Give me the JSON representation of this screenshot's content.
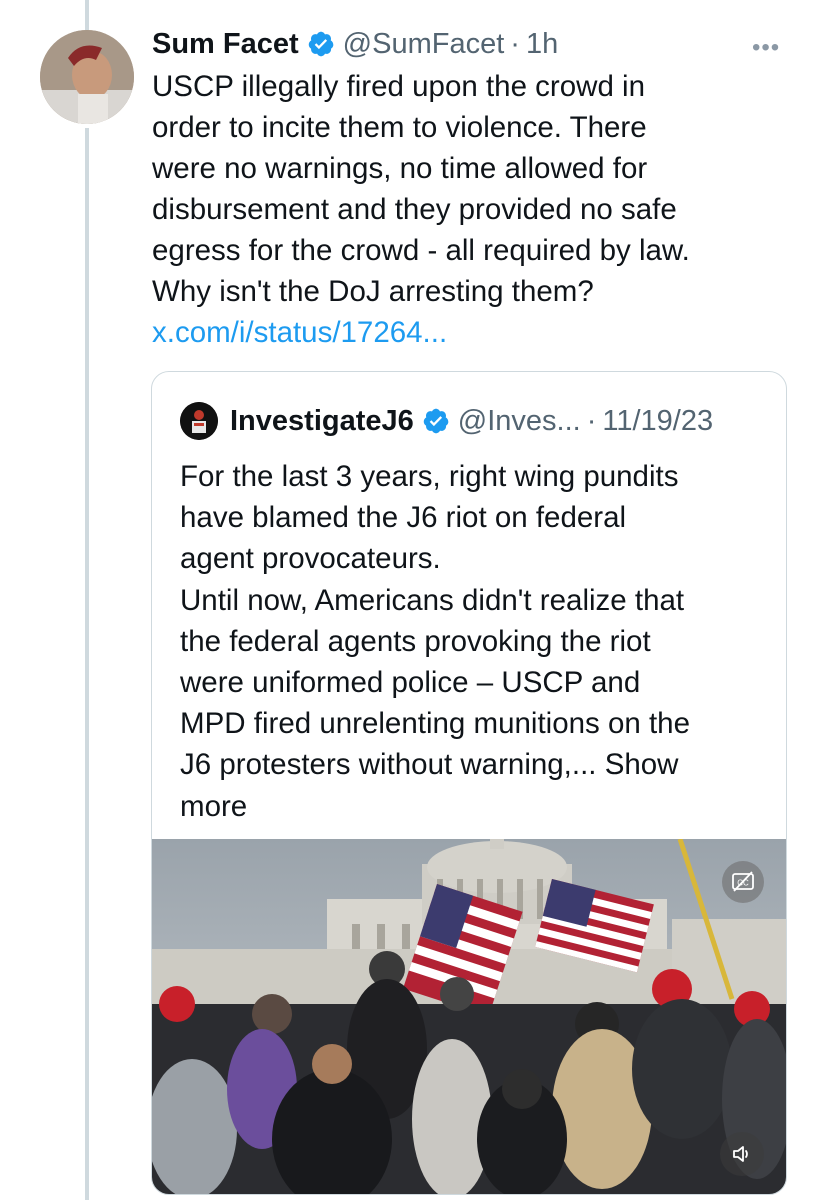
{
  "tweet": {
    "author_name": "Sum Facet",
    "handle": "@SumFacet",
    "separator": "·",
    "time": "1h",
    "more_label": "•••",
    "text": "USCP illegally fired upon the crowd in\norder to incite them to violence.  There\nwere no warnings, no time allowed for\ndisbursement and they provided no safe\negress for the crowd - all required by law.\nWhy isn't the DoJ arresting them?",
    "link": "x.com/i/status/17264..."
  },
  "quote": {
    "author_name": "InvestigateJ6",
    "handle": "@Inves...",
    "separator": "·",
    "date": "11/19/23",
    "text": "For the last 3 years, right wing pundits\nhave blamed the J6 riot on federal\nagent provocateurs.\nUntil now, Americans didn't realize that\nthe federal agents provoking the riot\nwere uniformed police – USCP and\nMPD fired unrelenting munitions on the\nJ6 protesters without warning,...",
    "show_more": "Show\nmore"
  },
  "media": {
    "cc_icon": "closed-captions-off-icon",
    "volume_icon": "volume-icon"
  },
  "colors": {
    "link": "#1d9bf0",
    "verified": "#1d9bf0",
    "secondary_text": "#536471",
    "border": "#cfd9de"
  }
}
